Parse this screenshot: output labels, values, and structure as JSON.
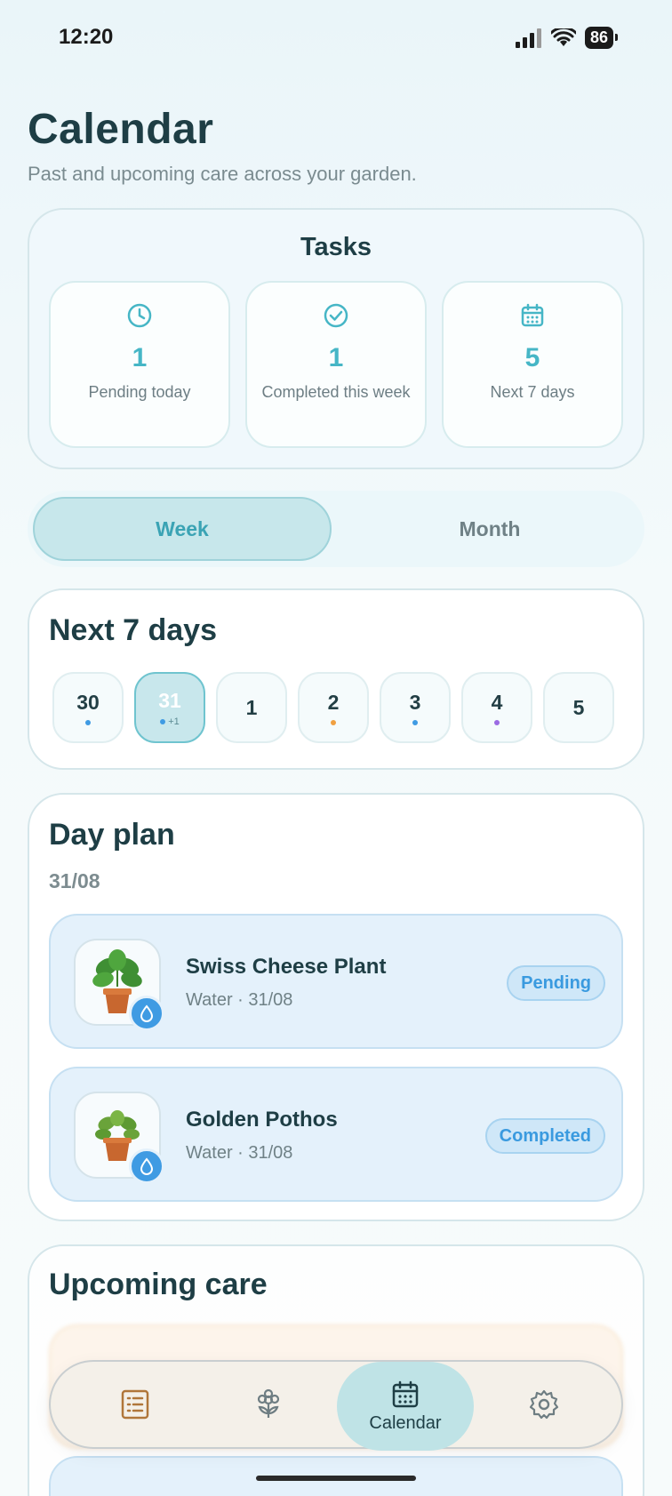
{
  "status": {
    "time": "12:20",
    "battery": "86"
  },
  "header": {
    "title": "Calendar",
    "subtitle": "Past and upcoming care across your garden."
  },
  "tasks": {
    "title": "Tasks",
    "stats": [
      {
        "icon": "clock-icon",
        "value": "1",
        "label": "Pending today"
      },
      {
        "icon": "check-circle-icon",
        "value": "1",
        "label": "Completed this week"
      },
      {
        "icon": "calendar-icon",
        "value": "5",
        "label": "Next 7 days"
      }
    ]
  },
  "view_toggle": {
    "week": "Week",
    "month": "Month",
    "selected": "Week"
  },
  "week": {
    "title": "Next 7 days",
    "days": [
      {
        "num": "30",
        "dot": "#3f9be3"
      },
      {
        "num": "31",
        "dot": "#3f9be3",
        "extra": "+1",
        "selected": true
      },
      {
        "num": "1",
        "dot": ""
      },
      {
        "num": "2",
        "dot": "#f0a040"
      },
      {
        "num": "3",
        "dot": "#3f9be3"
      },
      {
        "num": "4",
        "dot": "#9b6be3"
      },
      {
        "num": "5",
        "dot": ""
      }
    ]
  },
  "day_plan": {
    "title": "Day plan",
    "date": "31/08",
    "items": [
      {
        "plant": "Swiss Cheese Plant",
        "detail": "Water · 31/08",
        "status": "Pending"
      },
      {
        "plant": "Golden Pothos",
        "detail": "Water · 31/08",
        "status": "Completed"
      }
    ]
  },
  "upcoming": {
    "title": "Upcoming care"
  },
  "nav": {
    "active_label": "Calendar"
  },
  "colors": {
    "accent": "#46b6c6",
    "water": "#3f9be3"
  }
}
